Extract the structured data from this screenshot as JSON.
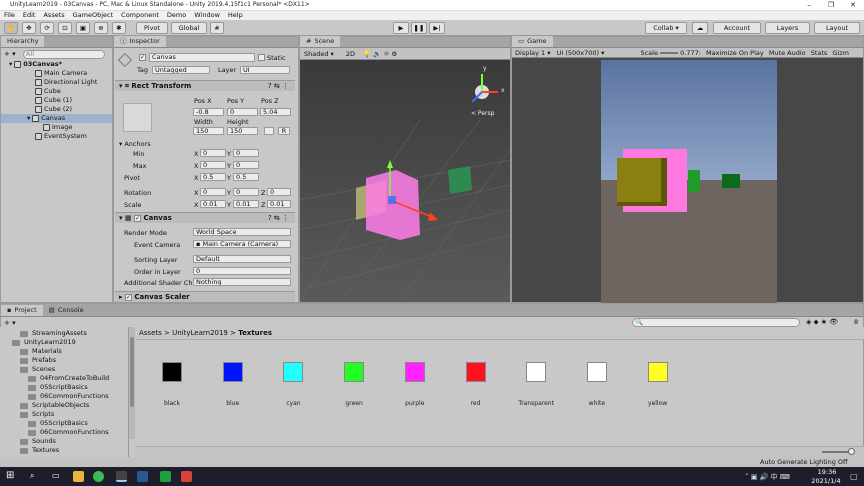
{
  "window": {
    "title": "UnityLearn2019 - 03Canvas - PC, Mac & Linux Standalone - Unity 2019.4.15f1c1 Personal* <DX11>",
    "controls": [
      "–",
      "❐",
      "✕"
    ]
  },
  "menu": [
    "File",
    "Edit",
    "Assets",
    "GameObject",
    "Component",
    "Demo",
    "Window",
    "Help"
  ],
  "toolbar": {
    "pivot": "Pivot",
    "global": "Global",
    "collab": "Collab ▾",
    "account": "Account",
    "layers": "Layers",
    "layout": "Layout"
  },
  "hierarchy": {
    "tab": "Hierarchy",
    "add": "+ ▾",
    "search_placeholder": "All",
    "scene": "03Canvas*",
    "items": [
      "Main Camera",
      "Directional Light",
      "Cube",
      "Cube (1)",
      "Cube (2)",
      "Canvas",
      "Image",
      "EventSystem"
    ]
  },
  "inspector": {
    "tab": "Inspector",
    "name": "Canvas",
    "static": "Static",
    "tag_label": "Tag",
    "tag": "Untagged",
    "layer_label": "Layer",
    "layer": "UI",
    "rect": {
      "title": "Rect Transform",
      "pos_headers": [
        "Pos X",
        "Pos Y",
        "Pos Z"
      ],
      "pos": [
        "-0.8",
        "0",
        "5.04"
      ],
      "size_headers": [
        "Width",
        "Height"
      ],
      "size": [
        "150",
        "150"
      ],
      "r_button": "R",
      "anchors": "Anchors",
      "min": "Min",
      "max": "Max",
      "pivot": "Pivot",
      "min_x": "0",
      "min_y": "0",
      "max_x": "0",
      "max_y": "0",
      "pivot_x": "0.5",
      "pivot_y": "0.5",
      "rotation": "Rotation",
      "rot": [
        "0",
        "0",
        "0"
      ],
      "scale": "Scale",
      "scl": [
        "0.01",
        "0.01",
        "0.01"
      ],
      "x": "X",
      "y": "Y",
      "z": "Z"
    },
    "canvas": {
      "title": "Canvas",
      "render_mode_label": "Render Mode",
      "render_mode": "World Space",
      "event_camera_label": "Event Camera",
      "event_camera": "Main Camera (Camera)",
      "sorting_layer_label": "Sorting Layer",
      "sorting_layer": "Default",
      "order_label": "Order in Layer",
      "order": "0",
      "shader_label": "Additional Shader Ch",
      "shader": "Nothing"
    },
    "next_component": "Canvas Scaler"
  },
  "scene": {
    "tab": "Scene",
    "shading": "Shaded",
    "mode": "2D",
    "persp": "< Persp"
  },
  "game": {
    "tab": "Game",
    "display": "Display 1",
    "resolution": "UI (500x700)",
    "scale_label": "Scale",
    "scale_value": "0.777:",
    "maximize": "Maximize On Play",
    "mute": "Mute Audio",
    "stats": "Stats",
    "gizmos": "Gizm"
  },
  "project": {
    "tab_project": "Project",
    "tab_console": "Console",
    "tree": [
      {
        "label": "StreamingAssets",
        "depth": 1
      },
      {
        "label": "UnityLearn2019",
        "depth": 0
      },
      {
        "label": "Materials",
        "depth": 1
      },
      {
        "label": "Prefabs",
        "depth": 1
      },
      {
        "label": "Scenes",
        "depth": 1
      },
      {
        "label": "04FromCreateToBuild",
        "depth": 2
      },
      {
        "label": "05ScriptBasics",
        "depth": 2
      },
      {
        "label": "06CommonFunctions",
        "depth": 2
      },
      {
        "label": "ScriptableObjects",
        "depth": 1
      },
      {
        "label": "Scripts",
        "depth": 1
      },
      {
        "label": "05ScriptBasics",
        "depth": 2
      },
      {
        "label": "06CommonFunctions",
        "depth": 2
      },
      {
        "label": "Sounds",
        "depth": 1
      },
      {
        "label": "Textures",
        "depth": 1
      }
    ],
    "breadcrumb": [
      "Assets",
      "UnityLearn2019",
      "Textures"
    ],
    "hidden_count": "8",
    "textures": [
      {
        "name": "black",
        "color": "#000000"
      },
      {
        "name": "blue",
        "color": "#0014ff"
      },
      {
        "name": "cyan",
        "color": "#22ffff"
      },
      {
        "name": "green",
        "color": "#22ff22"
      },
      {
        "name": "purple",
        "color": "#ff22ff"
      },
      {
        "name": "red",
        "color": "#ff1020"
      },
      {
        "name": "Transparent",
        "color": "#ffffff"
      },
      {
        "name": "white",
        "color": "#ffffff"
      },
      {
        "name": "yellow",
        "color": "#ffff22"
      }
    ]
  },
  "status": {
    "lighting": "Auto Generate Lighting Off"
  },
  "taskbar": {
    "time": "19:36",
    "date": "2021/1/4"
  }
}
